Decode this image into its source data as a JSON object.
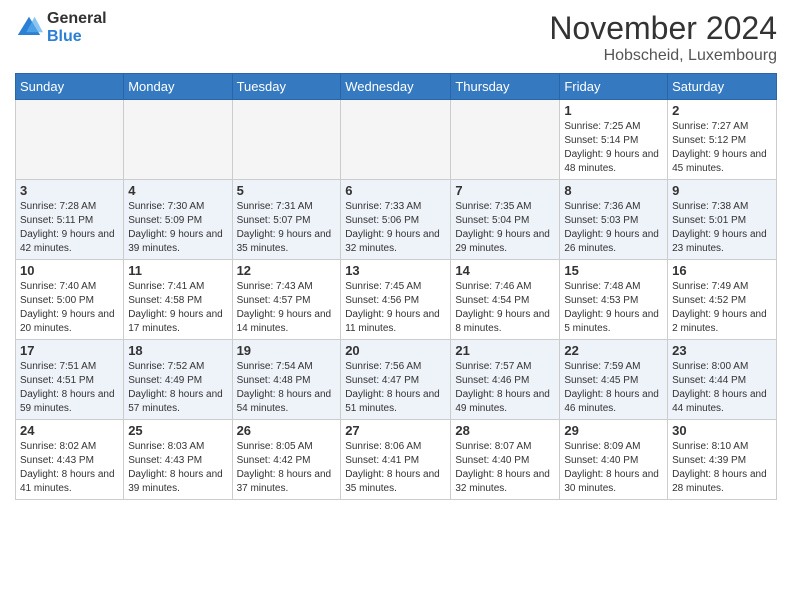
{
  "header": {
    "logo_general": "General",
    "logo_blue": "Blue",
    "month_title": "November 2024",
    "subtitle": "Hobscheid, Luxembourg"
  },
  "days_of_week": [
    "Sunday",
    "Monday",
    "Tuesday",
    "Wednesday",
    "Thursday",
    "Friday",
    "Saturday"
  ],
  "weeks": [
    [
      {
        "day": "",
        "info": ""
      },
      {
        "day": "",
        "info": ""
      },
      {
        "day": "",
        "info": ""
      },
      {
        "day": "",
        "info": ""
      },
      {
        "day": "",
        "info": ""
      },
      {
        "day": "1",
        "info": "Sunrise: 7:25 AM\nSunset: 5:14 PM\nDaylight: 9 hours\nand 48 minutes."
      },
      {
        "day": "2",
        "info": "Sunrise: 7:27 AM\nSunset: 5:12 PM\nDaylight: 9 hours\nand 45 minutes."
      }
    ],
    [
      {
        "day": "3",
        "info": "Sunrise: 7:28 AM\nSunset: 5:11 PM\nDaylight: 9 hours\nand 42 minutes."
      },
      {
        "day": "4",
        "info": "Sunrise: 7:30 AM\nSunset: 5:09 PM\nDaylight: 9 hours\nand 39 minutes."
      },
      {
        "day": "5",
        "info": "Sunrise: 7:31 AM\nSunset: 5:07 PM\nDaylight: 9 hours\nand 35 minutes."
      },
      {
        "day": "6",
        "info": "Sunrise: 7:33 AM\nSunset: 5:06 PM\nDaylight: 9 hours\nand 32 minutes."
      },
      {
        "day": "7",
        "info": "Sunrise: 7:35 AM\nSunset: 5:04 PM\nDaylight: 9 hours\nand 29 minutes."
      },
      {
        "day": "8",
        "info": "Sunrise: 7:36 AM\nSunset: 5:03 PM\nDaylight: 9 hours\nand 26 minutes."
      },
      {
        "day": "9",
        "info": "Sunrise: 7:38 AM\nSunset: 5:01 PM\nDaylight: 9 hours\nand 23 minutes."
      }
    ],
    [
      {
        "day": "10",
        "info": "Sunrise: 7:40 AM\nSunset: 5:00 PM\nDaylight: 9 hours\nand 20 minutes."
      },
      {
        "day": "11",
        "info": "Sunrise: 7:41 AM\nSunset: 4:58 PM\nDaylight: 9 hours\nand 17 minutes."
      },
      {
        "day": "12",
        "info": "Sunrise: 7:43 AM\nSunset: 4:57 PM\nDaylight: 9 hours\nand 14 minutes."
      },
      {
        "day": "13",
        "info": "Sunrise: 7:45 AM\nSunset: 4:56 PM\nDaylight: 9 hours\nand 11 minutes."
      },
      {
        "day": "14",
        "info": "Sunrise: 7:46 AM\nSunset: 4:54 PM\nDaylight: 9 hours\nand 8 minutes."
      },
      {
        "day": "15",
        "info": "Sunrise: 7:48 AM\nSunset: 4:53 PM\nDaylight: 9 hours\nand 5 minutes."
      },
      {
        "day": "16",
        "info": "Sunrise: 7:49 AM\nSunset: 4:52 PM\nDaylight: 9 hours\nand 2 minutes."
      }
    ],
    [
      {
        "day": "17",
        "info": "Sunrise: 7:51 AM\nSunset: 4:51 PM\nDaylight: 8 hours\nand 59 minutes."
      },
      {
        "day": "18",
        "info": "Sunrise: 7:52 AM\nSunset: 4:49 PM\nDaylight: 8 hours\nand 57 minutes."
      },
      {
        "day": "19",
        "info": "Sunrise: 7:54 AM\nSunset: 4:48 PM\nDaylight: 8 hours\nand 54 minutes."
      },
      {
        "day": "20",
        "info": "Sunrise: 7:56 AM\nSunset: 4:47 PM\nDaylight: 8 hours\nand 51 minutes."
      },
      {
        "day": "21",
        "info": "Sunrise: 7:57 AM\nSunset: 4:46 PM\nDaylight: 8 hours\nand 49 minutes."
      },
      {
        "day": "22",
        "info": "Sunrise: 7:59 AM\nSunset: 4:45 PM\nDaylight: 8 hours\nand 46 minutes."
      },
      {
        "day": "23",
        "info": "Sunrise: 8:00 AM\nSunset: 4:44 PM\nDaylight: 8 hours\nand 44 minutes."
      }
    ],
    [
      {
        "day": "24",
        "info": "Sunrise: 8:02 AM\nSunset: 4:43 PM\nDaylight: 8 hours\nand 41 minutes."
      },
      {
        "day": "25",
        "info": "Sunrise: 8:03 AM\nSunset: 4:43 PM\nDaylight: 8 hours\nand 39 minutes."
      },
      {
        "day": "26",
        "info": "Sunrise: 8:05 AM\nSunset: 4:42 PM\nDaylight: 8 hours\nand 37 minutes."
      },
      {
        "day": "27",
        "info": "Sunrise: 8:06 AM\nSunset: 4:41 PM\nDaylight: 8 hours\nand 35 minutes."
      },
      {
        "day": "28",
        "info": "Sunrise: 8:07 AM\nSunset: 4:40 PM\nDaylight: 8 hours\nand 32 minutes."
      },
      {
        "day": "29",
        "info": "Sunrise: 8:09 AM\nSunset: 4:40 PM\nDaylight: 8 hours\nand 30 minutes."
      },
      {
        "day": "30",
        "info": "Sunrise: 8:10 AM\nSunset: 4:39 PM\nDaylight: 8 hours\nand 28 minutes."
      }
    ]
  ]
}
